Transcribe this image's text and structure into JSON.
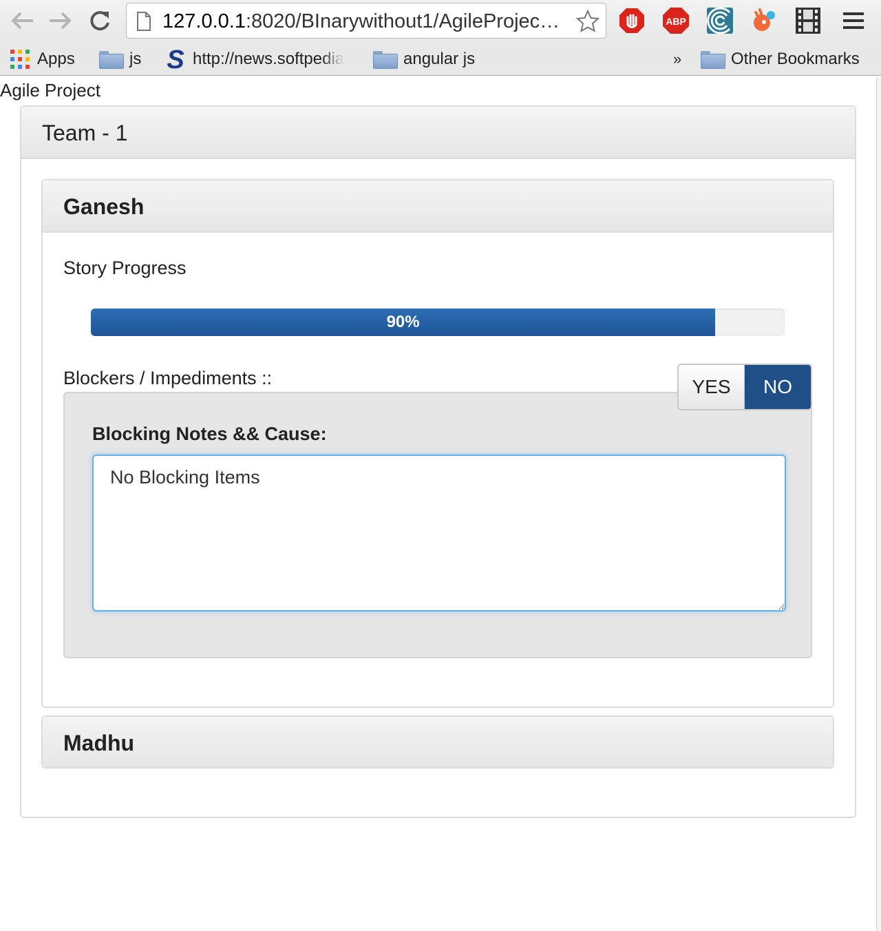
{
  "browser": {
    "url_host": "127.0.0.1",
    "url_rest": ":8020/BInarywithout1/AgileProjec…",
    "extensions": [
      "stop-hand-icon",
      "adblock-icon",
      "wave-icon",
      "bird-icon",
      "film-icon"
    ],
    "bookmarks": {
      "apps": "Apps",
      "js": "js",
      "softpedia": "http://news.softpedia",
      "angular": "angular js",
      "overflow": "»",
      "other": "Other Bookmarks"
    }
  },
  "page": {
    "title": "Agile Project",
    "team": {
      "name": "Team - 1",
      "members": [
        {
          "name": "Ganesh",
          "story_progress_label": "Story Progress",
          "progress_percent": 90,
          "progress_text": "90%",
          "blockers_label": "Blockers / Impediments ::",
          "toggle": {
            "yes": "YES",
            "no": "NO",
            "selected": "NO"
          },
          "notes_label": "Blocking Notes && Cause:",
          "notes_value": "No Blocking Items"
        },
        {
          "name": "Madhu"
        }
      ]
    }
  },
  "colors": {
    "progress_bar": "#1e5597",
    "toggle_selected": "#1f4f86",
    "focus_border": "#66afe9"
  }
}
